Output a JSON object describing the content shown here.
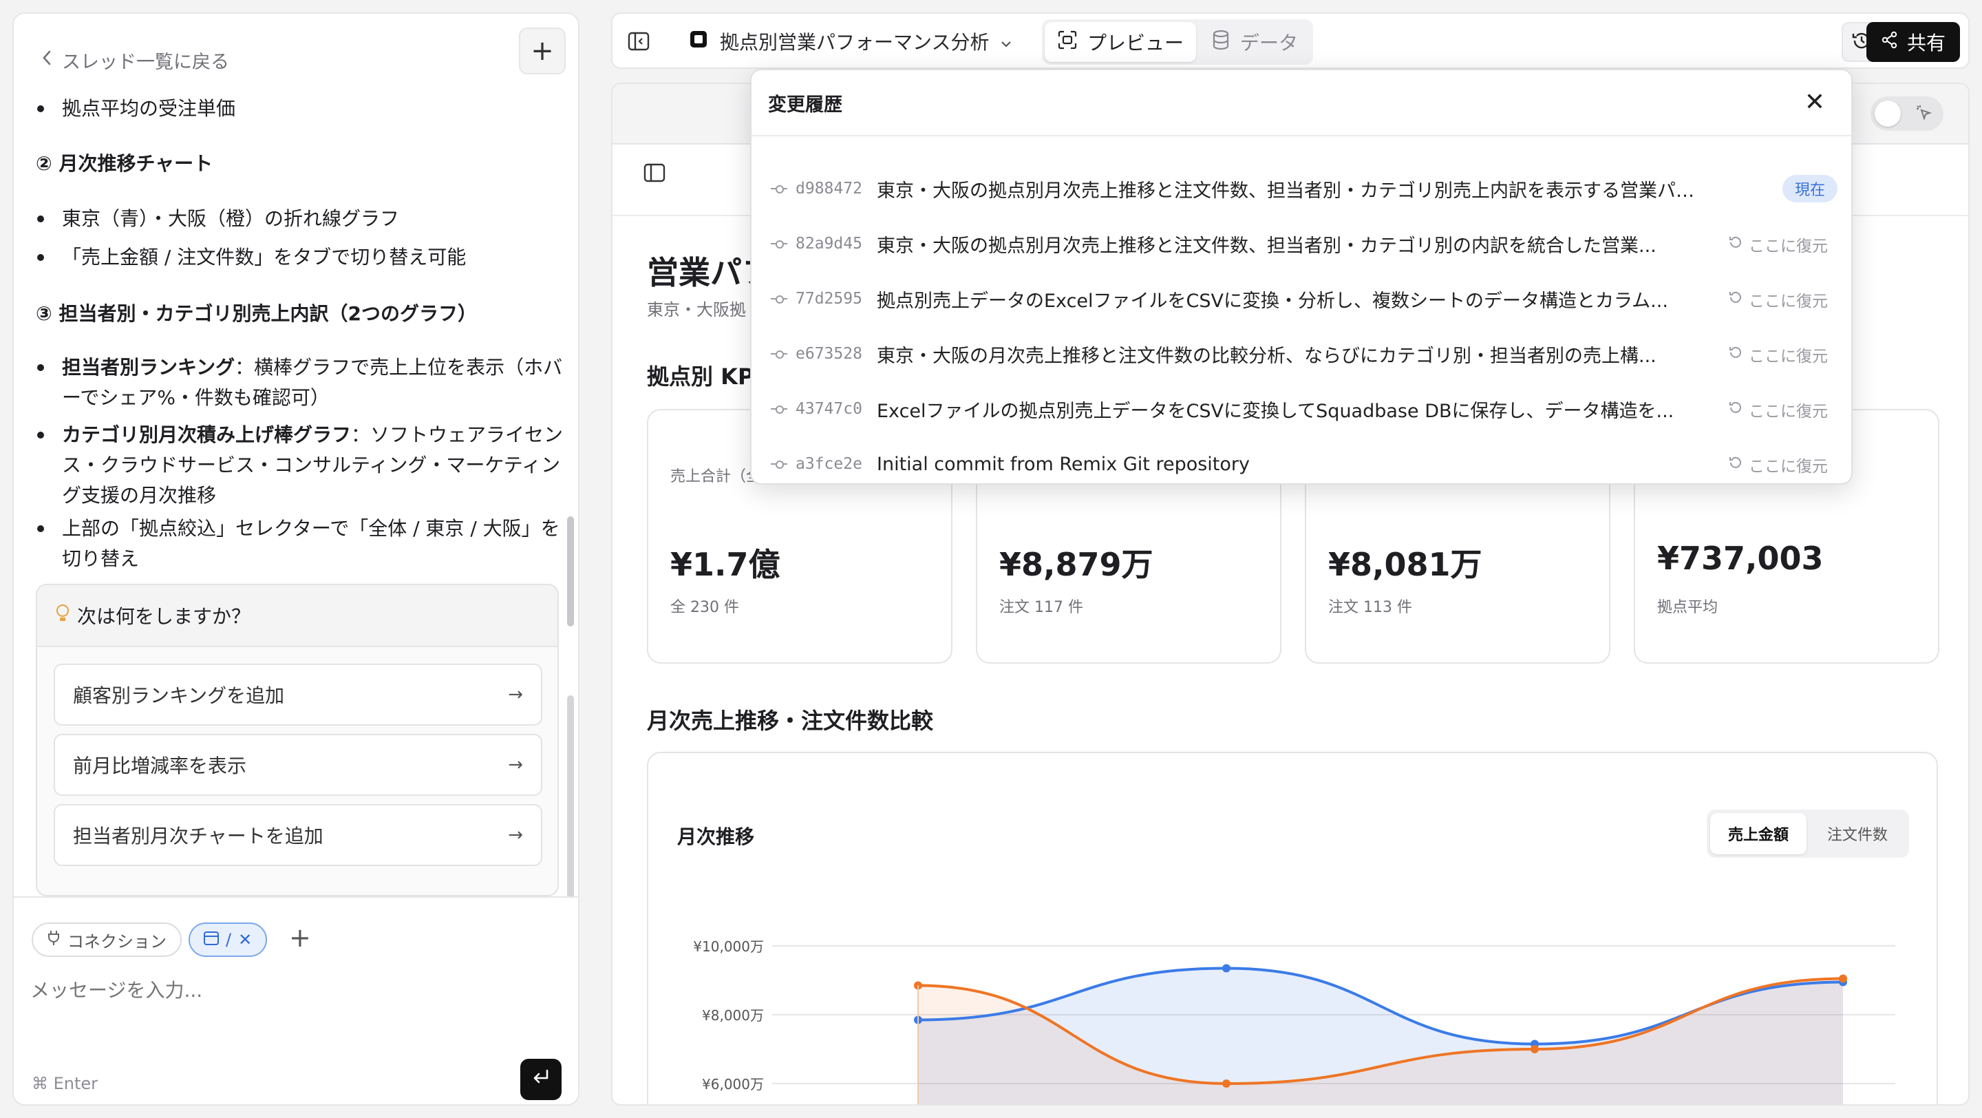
{
  "chat": {
    "back_label": "スレッド一覧に戻る",
    "new_thread_label": "+",
    "lines": {
      "b0": "拠点平均の受注単価",
      "h2": "② 月次推移チャート",
      "b1": "東京（青）・大阪（橙）の折れ線グラフ",
      "b2": "「売上金額 / 注文件数」をタブで切り替え可能",
      "h3": "③ 担当者別・カテゴリ別売上内訳（2つのグラフ）",
      "b3_bold": "担当者別ランキング",
      "b3_rest": "：横棒グラフで売上上位を表示（ホバーでシェア%・件数も確認可）",
      "b4_bold": "カテゴリ別月次積み上げ棒グラフ",
      "b4_rest": "：ソフトウェアライセンス・クラウドサービス・コンサルティング・マーケティング支援の月次推移",
      "b5": "上部の「拠点絞込」セレクターで「全体 / 東京 / 大阪」を切り替え"
    },
    "next": {
      "title": "次は何をしますか？",
      "suggestions": [
        "顧客別ランキングを追加",
        "前月比増減率を表示",
        "担当者別月次チャートを追加"
      ]
    },
    "composer": {
      "connection_chip": "コネクション",
      "selection_chip": "/",
      "placeholder": "メッセージを入力...",
      "enter_hint": "⌘ Enter"
    }
  },
  "topbar": {
    "app_name": "拠点別営業パフォーマンス分析",
    "tabs": [
      "プレビュー",
      "データ"
    ],
    "share_label": "共有"
  },
  "dashboard": {
    "title": "営業パフ",
    "subtitle": "東京・大阪拠",
    "kpi_heading": "拠点別 KP",
    "kpis": [
      {
        "label": "売上合計（全",
        "value": "¥1.7億",
        "note": "全 230 件"
      },
      {
        "label": "",
        "value": "¥8,879万",
        "note": "注文 117 件"
      },
      {
        "label": "",
        "value": "¥8,081万",
        "note": "注文 113 件"
      },
      {
        "label": "",
        "value": "¥737,003",
        "note": "拠点平均"
      }
    ],
    "chart_heading": "月次売上推移・注文件数比較",
    "chart_title": "月次推移",
    "chart_tabs": [
      "売上金額",
      "注文件数"
    ]
  },
  "history": {
    "title": "変更履歴",
    "current_label": "現在",
    "restore_label": "ここに復元",
    "commits": [
      {
        "hash": "d988472",
        "message": "東京・大阪の拠点別月次売上推移と注文件数、担当者別・カテゴリ別売上内訳を表示する営業パフォ..."
      },
      {
        "hash": "82a9d45",
        "message": "東京・大阪の拠点別月次売上推移と注文件数、担当者別・カテゴリ別の内訳を統合した営業..."
      },
      {
        "hash": "77d2595",
        "message": "拠点別売上データのExcelファイルをCSVに変換・分析し、複数シートのデータ構造とカラム..."
      },
      {
        "hash": "e673528",
        "message": "東京・大阪の月次売上推移と注文件数の比較分析、ならびにカテゴリ別・担当者別の売上構..."
      },
      {
        "hash": "43747c0",
        "message": "Excelファイルの拠点別売上データをCSVに変換してSquadbase DBに保存し、データ構造を..."
      },
      {
        "hash": "a3fce2e",
        "message": "Initial commit from Remix Git repository"
      }
    ]
  },
  "chart_data": {
    "type": "area",
    "x_index": [
      0,
      1,
      2,
      3
    ],
    "series": [
      {
        "values": [
          7850,
          9350,
          7150,
          8950
        ],
        "color": "#3b7be8"
      },
      {
        "values": [
          8850,
          6000,
          7000,
          9050
        ],
        "color": "#ef7524"
      }
    ],
    "ytick_labels": [
      "¥10,000万",
      "¥8,000万",
      "¥6,000万"
    ],
    "ytick_values": [
      10000,
      8000,
      6000
    ],
    "grid": true
  }
}
